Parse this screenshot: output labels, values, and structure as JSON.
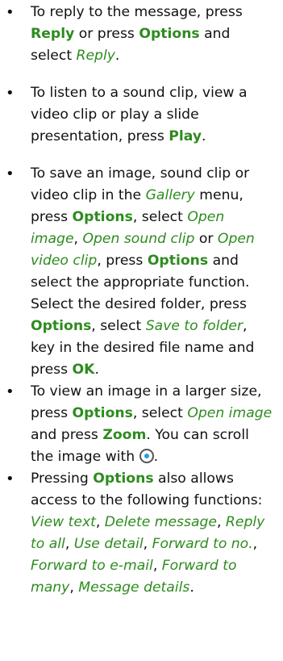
{
  "bullet": "•",
  "items": [
    {
      "p1": "To reply to the message, press ",
      "k1": "Reply",
      "p2": " or press ",
      "k2": "Options",
      "p3": " and select ",
      "i1": "Reply",
      "p4": "."
    },
    {
      "p1": "To listen to a sound clip, view a video clip or play a slide presentation, press ",
      "k1": "Play",
      "p2": "."
    },
    {
      "p1": "To save an image, sound clip or video clip in the ",
      "i1": "Gallery",
      "p2": " menu, press ",
      "k1": "Options",
      "p3": ", select ",
      "i2": "Open image",
      "p4": ", ",
      "i3": "Open sound clip",
      "p5": " or ",
      "i4": "Open video clip",
      "p6": ", press ",
      "k2": "Options",
      "p7": " and select the appropriate function. Select the desired folder, press ",
      "k3": "Options",
      "p8": ", select ",
      "i5": "Save to folder",
      "p9": ", key in the desired file name and press ",
      "k4": "OK",
      "p10": "."
    },
    {
      "p1": "To view an image in a larger size, press ",
      "k1": "Options",
      "p2": ", select ",
      "i1": "Open image",
      "p3": " and press ",
      "k2": "Zoom",
      "p4": ". You can scroll the image with ",
      "p5": "."
    },
    {
      "p1": "Pressing ",
      "k1": "Options",
      "p2": " also allows access to the following functions: ",
      "i1": "View text",
      "p3": ", ",
      "i2": "Delete message",
      "p4": ", ",
      "i3": "Reply to all",
      "p5": ", ",
      "i4": "Use detail",
      "p6": ", ",
      "i5": "Forward to no.",
      "p7": ", ",
      "i6": "Forward to e-mail",
      "p8": ", ",
      "i7": "Forward to many",
      "p9": ", ",
      "i8": "Message details",
      "p10": "."
    }
  ]
}
